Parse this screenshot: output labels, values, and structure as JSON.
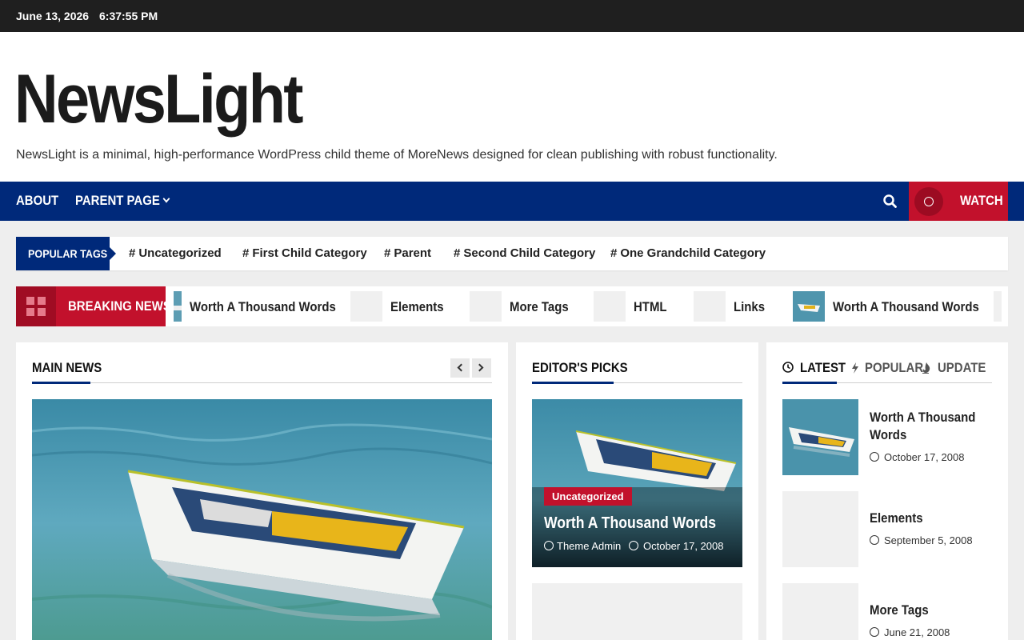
{
  "topbar": {
    "date": "June 13, 2026",
    "time": "6:37:55 PM"
  },
  "site": {
    "title": "NewsLight",
    "tagline": "NewsLight is a minimal, high-performance WordPress child theme of MoreNews designed for clean publishing with robust functionality."
  },
  "nav": {
    "items": [
      {
        "label": "About"
      },
      {
        "label": "Parent Page"
      }
    ],
    "search_icon": "search-icon",
    "watch_label": "Watch"
  },
  "popular_tags": {
    "heading": "Popular Tags",
    "tags": [
      "Uncategorized",
      "First Child Category",
      "Parent",
      "Second Child Category",
      "One Grandchild Category"
    ]
  },
  "breaking": {
    "heading": "Breaking News",
    "items": [
      "Worth A Thousand Words",
      "Elements",
      "More Tags",
      "HTML",
      "Links",
      "Worth A Thousand Words"
    ]
  },
  "main_news": {
    "heading": "Main News"
  },
  "editors_picks": {
    "heading": "Editor's Picks",
    "featured": {
      "category": "Uncategorized",
      "title": "Worth A Thousand Words",
      "author": "Theme Admin",
      "date": "October 17, 2008"
    }
  },
  "sidebar": {
    "tabs": [
      "Latest",
      "Popular",
      "Update"
    ],
    "posts": [
      {
        "title": "Worth A Thousand Words",
        "date": "October 17, 2008"
      },
      {
        "title": "Elements",
        "date": "September 5, 2008"
      },
      {
        "title": "More Tags",
        "date": "June 21, 2008"
      }
    ]
  },
  "colors": {
    "brand_blue": "#00297a",
    "accent_red": "#c2112c",
    "topbar": "#1f1f1f"
  }
}
